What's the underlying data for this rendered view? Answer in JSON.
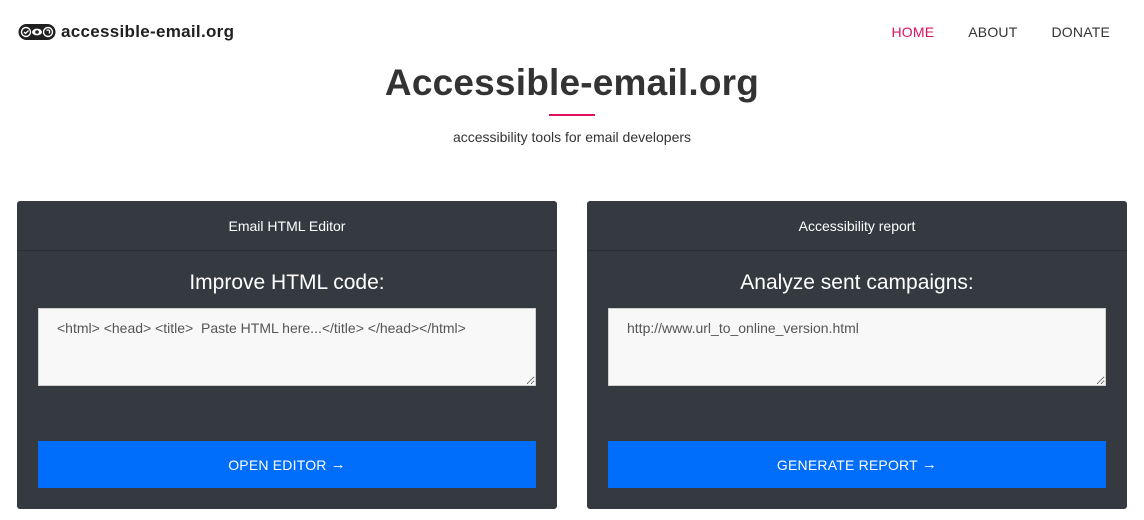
{
  "brand": {
    "name": "accessible-email.org"
  },
  "nav": {
    "items": [
      {
        "label": "HOME",
        "active": true
      },
      {
        "label": "ABOUT",
        "active": false
      },
      {
        "label": "DONATE",
        "active": false
      }
    ]
  },
  "hero": {
    "title": "Accessible-email.org",
    "subtitle": "accessibility tools for email developers"
  },
  "cards": [
    {
      "header": "Email HTML Editor",
      "heading": "Improve HTML code:",
      "placeholder": "<html> <head> <title>  Paste HTML here...</title> </head></html>",
      "button": "OPEN EDITOR",
      "button_icon": "arrow-right-icon"
    },
    {
      "header": "Accessibility report",
      "heading": "Analyze sent campaigns:",
      "placeholder": "http://www.url_to_online_version.html",
      "button": "GENERATE REPORT",
      "button_icon": "arrow-right-icon"
    }
  ],
  "colors": {
    "accent": "#e0115f",
    "card_bg": "#343a40",
    "button_bg": "#006dfb",
    "text_dark": "#333333"
  }
}
